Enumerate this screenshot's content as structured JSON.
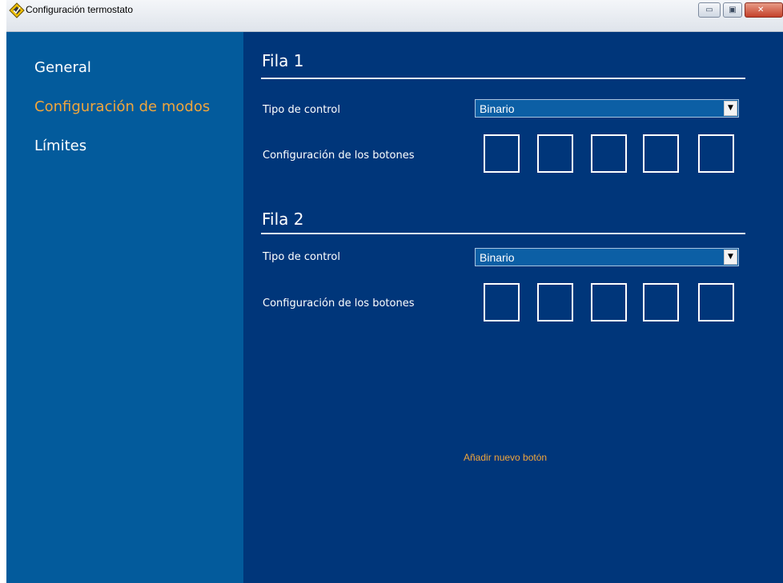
{
  "window": {
    "title": "Configuración termostato",
    "icon": "thermostat-app-icon",
    "controls": {
      "minimize": "▭",
      "maximize": "▣",
      "close": "✕"
    }
  },
  "sidebar": {
    "items": [
      {
        "label": "General",
        "active": false
      },
      {
        "label": "Configuración de modos",
        "active": true
      },
      {
        "label": "Límites",
        "active": false
      }
    ]
  },
  "rows": [
    {
      "title": "Fila 1",
      "control_label": "Tipo de control",
      "control_value": "Binario",
      "buttons_label": "Configuración de los botones",
      "button_slots": 5
    },
    {
      "title": "Fila 2",
      "control_label": "Tipo de control",
      "control_value": "Binario",
      "buttons_label": "Configuración de los botones",
      "button_slots": 5
    }
  ],
  "add_button_label": "Añadir nuevo botón",
  "colors": {
    "sidebar_bg": "#035b9c",
    "main_bg": "#00367a",
    "accent": "#f0a63c",
    "select_bg": "#0c5fa5"
  }
}
